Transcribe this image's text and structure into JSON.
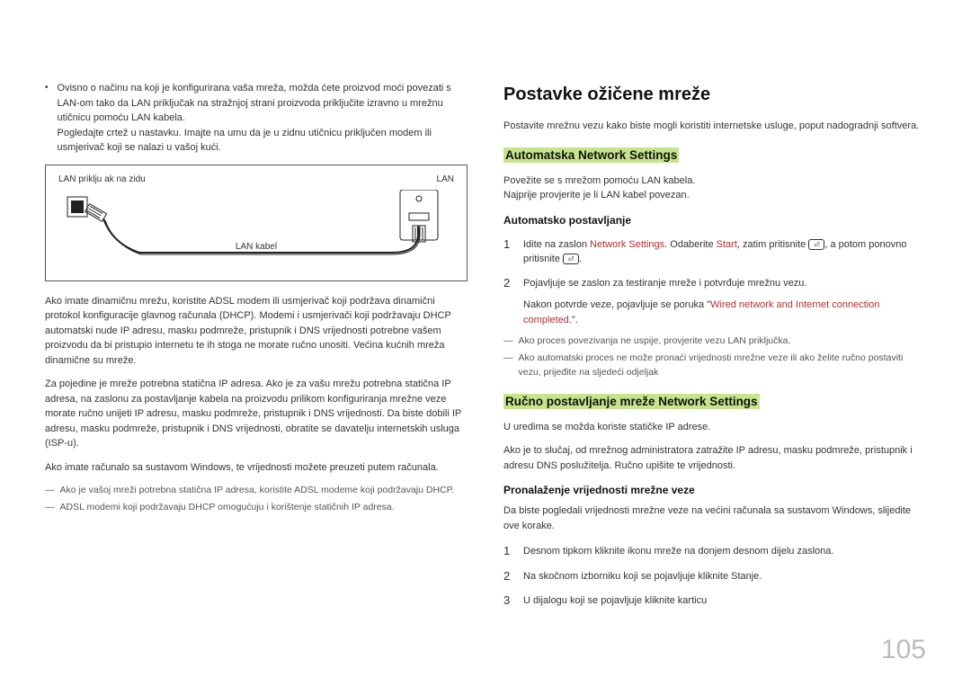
{
  "left": {
    "bullet": "Ovisno o načinu na koji je konfigurirana vaša mreža, možda ćete proizvod moći povezati s LAN-om tako da LAN priključak na stražnjoj strani proizvoda priključite izravno u mrežnu utičnicu pomoću LAN kabela.",
    "bullet2": "Pogledajte crtež u nastavku. Imajte na umu da je u zidnu utičnicu priključen modem ili usmjerivač koji se nalazi u vašoj kući.",
    "diagram": {
      "wall": "LAN priklju ak na zidu",
      "lan": "LAN",
      "cable": "LAN kabel"
    },
    "p1": "Ako imate dinamičnu mrežu, koristite ADSL modem ili usmjerivač koji podržava dinamični protokol konfiguracije glavnog računala (DHCP). Modemi i usmjerivači koji podržavaju DHCP automatski nude IP adresu, masku podmreže, pristupnik i DNS vrijednosti potrebne vašem proizvodu da bi pristupio internetu te ih stoga ne morate ručno unositi. Većina kućnih mreža dinamične su mreže.",
    "p2": "Za pojedine je mreže potrebna statična IP adresa. Ako je za vašu mrežu potrebna statična IP adresa, na zaslonu za postavljanje kabela na proizvodu prilikom konfiguriranja mrežne veze morate ručno unijeti IP adresu, masku podmreže, pristupnik i DNS vrijednosti. Da biste dobili IP adresu, masku podmreže, pristupnik i DNS vrijednosti, obratite se davatelju internetskih usluga (ISP-u).",
    "p3": "Ako imate računalo sa sustavom Windows, te vrijednosti možete preuzeti putem računala.",
    "d1": "Ako je vašoj mreži potrebna statična IP adresa, koristite ADSL modeme koji podržavaju DHCP.",
    "d2": "ADSL modemi koji podržavaju DHCP omogućuju i korištenje statičnih IP adresa."
  },
  "right": {
    "title": "Postavke ožičene mreže",
    "intro": "Postavite mrežnu vezu kako biste mogli koristiti internetske usluge, poput nadogradnji softvera.",
    "h2a": "Automatska Network Settings",
    "a_p1": "Povežite se s mrežom pomoću LAN kabela.",
    "a_p2": "Najprije provjerite je li LAN kabel povezan.",
    "h3a": "Automatsko postavljanje",
    "step1_pre": "Idite na zaslon ",
    "step1_hl1": "Network Settings",
    "step1_mid": ". Odaberite ",
    "step1_hl2": "Start",
    "step1_mid2": ", zatim pritisnite ",
    "step1_post": ", a potom ponovno pritisnite ",
    "step1_end": ".",
    "step2": "Pojavljuje se zaslon za testiranje mreže i potvrđuje mrežnu vezu.",
    "step2b_pre": "Nakon potvrde veze, pojavljuje se poruka \"",
    "step2b_hl": "Wired network and Internet connection completed.",
    "step2b_post": "\".",
    "da1": "Ako proces povezivanja ne uspije, provjerite vezu LAN priključka.",
    "da2": "Ako automatski proces ne može pronaći vrijednosti mrežne veze ili ako želite ručno postaviti vezu, prijeđite na sljedeći odjeljak",
    "h2b": "Ručno postavljanje mreže Network Settings",
    "b_p1": "U uredima se možda koriste statičke IP adrese.",
    "b_p2": "Ako je to slučaj, od mrežnog administratora zatražite IP adresu, masku podmreže, pristupnik i adresu DNS poslužitelja. Ručno upišite te vrijednosti.",
    "h3b": "Pronalaženje vrijednosti mrežne veze",
    "b_intro": "Da biste pogledali vrijednosti mrežne veze na većini računala sa sustavom Windows, slijedite ove korake.",
    "bs1": "Desnom tipkom kliknite ikonu mreže na donjem desnom dijelu zaslona.",
    "bs2": "Na skočnom izborniku koji se pojavljuje kliknite Stanje.",
    "bs3": "U dijalogu koji se pojavljuje kliknite karticu "
  },
  "pagenum": "105"
}
